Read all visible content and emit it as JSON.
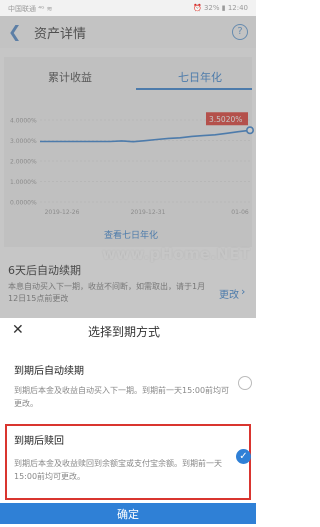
{
  "status_bar": {
    "carrier": "中国联通 ⁴ᴳ ≋",
    "right": "⏰ 32% ▮ 12:40"
  },
  "header": {
    "title": "资产详情",
    "help": "?"
  },
  "tabs": [
    {
      "label": "累计收益"
    },
    {
      "label": "七日年化"
    }
  ],
  "chart_data": {
    "type": "line",
    "x": [
      "2019-12-26",
      "2019-12-31",
      "01-06"
    ],
    "yticks": [
      "4.0000%",
      "3.0000%",
      "2.0000%",
      "1.0000%",
      "0.0000%"
    ],
    "ylim": [
      0,
      4
    ],
    "series": [
      {
        "values": [
          2.95,
          2.95,
          2.95,
          2.95,
          2.95,
          2.95,
          2.95,
          2.98,
          2.94,
          2.99,
          3.05,
          3.1,
          3.13,
          3.2,
          3.24,
          3.28,
          3.35,
          3.43,
          3.5
        ]
      }
    ],
    "last_label": "3.5020%"
  },
  "chart_link": "查看七日年化",
  "renew": {
    "title": "6天后自动续期",
    "desc": "本息自动买入下一期，收益不间断，如需取出，请于1月12日15点前更改",
    "change": "更改"
  },
  "watermark": "www.pHome.NET",
  "sheet": {
    "close": "✕",
    "title": "选择到期方式",
    "option1": {
      "title": "到期后自动续期",
      "desc": "到期后本金及收益自动买入下一期。到期前一天15:00前均可更改。"
    },
    "option2": {
      "title": "到期后赎回",
      "desc": "到期后本金及收益赎回到余额宝或支付宝余额。到期前一天15:00前均可更改。"
    },
    "confirm": "确定"
  }
}
